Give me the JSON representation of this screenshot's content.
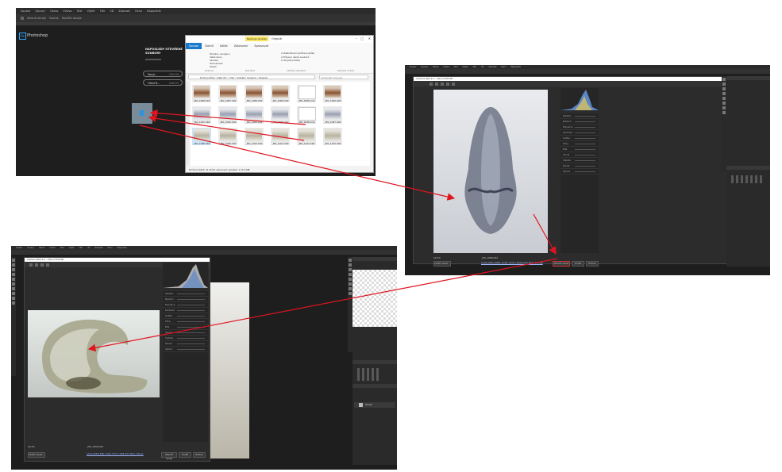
{
  "shot1": {
    "menu": [
      "Soubor",
      "Úpravy",
      "Obraz",
      "Vrstva",
      "Text",
      "Výběr",
      "Filtr",
      "3D",
      "Zobrazit",
      "Okno",
      "Nápověda"
    ],
    "toolbar": [
      "Sklonit okraje",
      "Vzorek",
      "Rozšířit okraje"
    ],
    "app_title": "Photoshop",
    "heading_line1": "NAPOSLEDY OTEVŘENÉ",
    "heading_line2": "SOUBORY",
    "new_btn": "Nový...",
    "new_shortcut": "Ctrl+N",
    "open_btn": "Otevřít...",
    "open_shortcut": "Ctrl+O"
  },
  "explorer": {
    "tools_tab": "Nástroje obrázku",
    "window_title": "Originál",
    "tabs": [
      "Soubor",
      "Domů",
      "Sdílet",
      "Zobrazení",
      "Spravovat"
    ],
    "view_options": [
      "Podokno navigace",
      "Velké ikony",
      "Seznam",
      "Podrobnosti",
      "Obsah"
    ],
    "checkboxes": [
      "Zaškrtávací políčka položek",
      "Přípony názvů souborů",
      "Skryté položky"
    ],
    "sections": [
      "Podokna",
      "Rozložení",
      "Aktuální zobrazení",
      "Zobrazit či skrýt"
    ],
    "address": [
      "Tento počítač",
      "Data (D:)",
      "Foto",
      "Virtuální muzeum",
      "Originál"
    ],
    "search_placeholder": "Prohledat: Originál",
    "files_row1": [
      "_MG_1098.CR2",
      "_MG_1087.CR2",
      "_MG_1088.CR2",
      "_MG_1089.CR2",
      "_MG_1089.xmp",
      "_MG_1090.CR2"
    ],
    "files_row2": [
      "_MG_1091.CR2",
      "_MG_1092.CR2",
      "_MG_1094.CR2",
      "_MG_1096.CR2",
      "_MG_1096.xmp",
      "_MG_1097.CR2"
    ],
    "files_row3": [
      "_MG_1098.CR2",
      "_MG_1099.CR2",
      "_MG_1100.CR2",
      "_MG_1101.CR2",
      "_MG_1102.CR2",
      "_MG_1103.CR2"
    ],
    "status": "Počet položek: 51    Počet vybraných položek: 1  23,4 MB"
  },
  "shot2": {
    "title": "Camera Raw 9.1 - Canon EOS 6D",
    "zoom": "14,3%",
    "filename": "_MG_1096.CR2",
    "info": "Adobe RGB (1998); 8 bitů; 5472 x 3648 (20,0 Mpx); 240 ppi",
    "btn_save": "Uložit obraz...",
    "btn_open": "Otevřít obraz",
    "btn_cancel": "Zrušit",
    "btn_done": "Hotovo",
    "panel_rows": [
      "Teplota",
      "Nádech",
      "Expozice",
      "Kontrast",
      "Světla",
      "Stíny",
      "Bílé",
      "Černé",
      "Čistota",
      "Živost",
      "Sytost"
    ]
  },
  "shot3": {
    "title": "Camera Raw 9.1 - Canon EOS 6D",
    "zoom": "16,4%",
    "filename": "_MG_1099.CR2",
    "info": "Adobe RGB (1998); 8 bitů; 5472 x 3648 (20,0 Mpx); 240 ppi",
    "btn_save": "Uložit obraz...",
    "btn_open": "Otevřít obraz",
    "btn_cancel": "Zrušit",
    "btn_done": "Hotovo",
    "panel_rows": [
      "Teplota",
      "Nádech",
      "Expozice",
      "Kontrast",
      "Světla",
      "Stíny",
      "Bílé",
      "Černé",
      "Čistota",
      "Živost",
      "Sytost"
    ],
    "layer_name": "Pozadí"
  },
  "colors": {
    "arrow": "#e0141e",
    "ps_blue": "#31a8ff",
    "dark_bg": "#1e1e1e",
    "explorer_accent": "#1979ca"
  }
}
